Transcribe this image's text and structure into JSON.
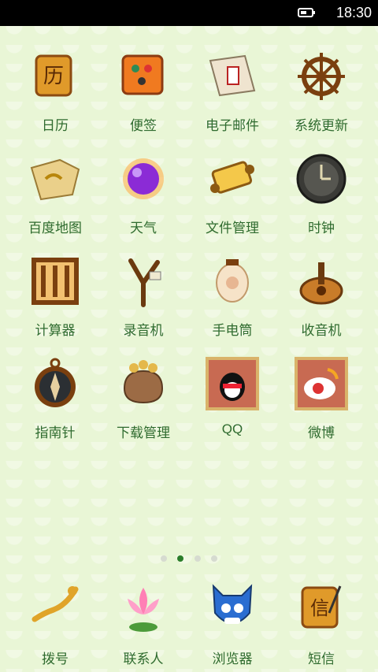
{
  "status_bar": {
    "time": "18:30",
    "battery_icon": "battery-icon"
  },
  "apps": [
    {
      "label": "日历",
      "icon": "calendar-scroll-icon"
    },
    {
      "label": "便签",
      "icon": "notes-scroll-icon"
    },
    {
      "label": "电子邮件",
      "icon": "envelope-icon"
    },
    {
      "label": "系统更新",
      "icon": "ship-wheel-icon"
    },
    {
      "label": "百度地图",
      "icon": "map-icon"
    },
    {
      "label": "天气",
      "icon": "crystal-orb-icon"
    },
    {
      "label": "文件管理",
      "icon": "scroll-file-icon"
    },
    {
      "label": "时钟",
      "icon": "clock-icon"
    },
    {
      "label": "计算器",
      "icon": "abacus-icon"
    },
    {
      "label": "录音机",
      "icon": "slingshot-icon"
    },
    {
      "label": "手电筒",
      "icon": "lantern-icon"
    },
    {
      "label": "收音机",
      "icon": "pipa-icon"
    },
    {
      "label": "指南针",
      "icon": "compass-icon"
    },
    {
      "label": "下载管理",
      "icon": "money-bag-icon"
    },
    {
      "label": "QQ",
      "icon": "qq-penguin-icon"
    },
    {
      "label": "微博",
      "icon": "weibo-icon"
    }
  ],
  "page_indicator": {
    "count": 4,
    "active_index": 1
  },
  "dock": [
    {
      "label": "拨号",
      "icon": "ruyi-icon"
    },
    {
      "label": "联系人",
      "icon": "lotus-icon"
    },
    {
      "label": "浏览器",
      "icon": "opera-mask-icon"
    },
    {
      "label": "短信",
      "icon": "message-scroll-icon"
    }
  ]
}
